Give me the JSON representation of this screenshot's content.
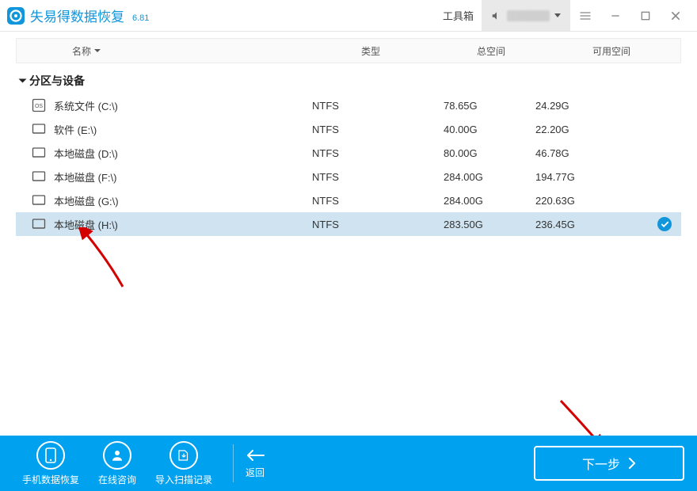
{
  "app": {
    "title": "失易得数据恢复",
    "version": "6.81"
  },
  "titlebar": {
    "toolbox_label": "工具箱"
  },
  "columns": {
    "name": "名称",
    "type": "类型",
    "total": "总空间",
    "free": "可用空间"
  },
  "section": {
    "partitions_label": "分区与设备"
  },
  "drives": [
    {
      "icon": "os",
      "name": "系统文件 (C:\\)",
      "type": "NTFS",
      "total": "78.65G",
      "free": "24.29G",
      "selected": false
    },
    {
      "icon": "disk",
      "name": "软件 (E:\\)",
      "type": "NTFS",
      "total": "40.00G",
      "free": "22.20G",
      "selected": false
    },
    {
      "icon": "disk",
      "name": "本地磁盘 (D:\\)",
      "type": "NTFS",
      "total": "80.00G",
      "free": "46.78G",
      "selected": false
    },
    {
      "icon": "disk",
      "name": "本地磁盘 (F:\\)",
      "type": "NTFS",
      "total": "284.00G",
      "free": "194.77G",
      "selected": false
    },
    {
      "icon": "disk",
      "name": "本地磁盘 (G:\\)",
      "type": "NTFS",
      "total": "284.00G",
      "free": "220.63G",
      "selected": false
    },
    {
      "icon": "disk",
      "name": "本地磁盘 (H:\\)",
      "type": "NTFS",
      "total": "283.50G",
      "free": "236.45G",
      "selected": true
    }
  ],
  "footer": {
    "phone_recovery": "手机数据恢复",
    "online_support": "在线咨询",
    "import_scan": "导入扫描记录",
    "back": "返回",
    "next": "下一步"
  }
}
